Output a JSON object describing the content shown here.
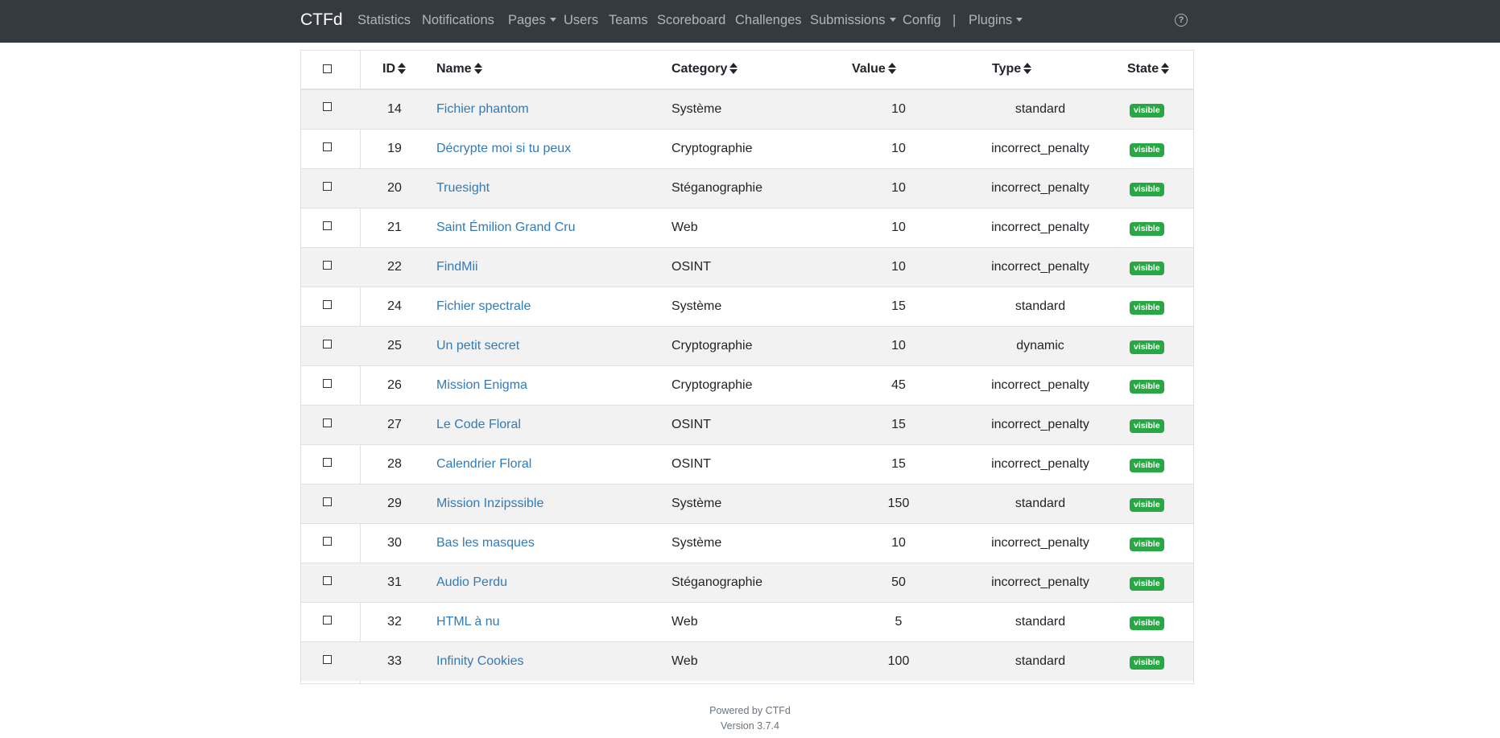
{
  "navbar": {
    "brand": "CTFd",
    "items": [
      {
        "label": "Statistics"
      },
      {
        "label": "Notifications"
      },
      {
        "label": "Pages",
        "dropdown": true
      },
      {
        "label": "Users"
      },
      {
        "label": "Teams"
      },
      {
        "label": "Scoreboard"
      },
      {
        "label": "Challenges"
      },
      {
        "label": "Submissions",
        "dropdown": true
      },
      {
        "label": "Config"
      },
      {
        "label": "|"
      },
      {
        "label": "Plugins",
        "dropdown": true
      }
    ],
    "help_icon": "question-circle-icon",
    "background": "#343a40"
  },
  "table": {
    "headers": {
      "id": "ID",
      "name": "Name",
      "category": "Category",
      "value": "Value",
      "type": "Type",
      "state": "State"
    },
    "rows": [
      {
        "id": "14",
        "name": "Fichier phantom",
        "category": "Système",
        "value": "10",
        "type": "standard",
        "state": "visible"
      },
      {
        "id": "19",
        "name": "Décrypte moi si tu peux",
        "category": "Cryptographie",
        "value": "10",
        "type": "incorrect_penalty",
        "state": "visible"
      },
      {
        "id": "20",
        "name": "Truesight",
        "category": "Stéganographie",
        "value": "10",
        "type": "incorrect_penalty",
        "state": "visible"
      },
      {
        "id": "21",
        "name": "Saint Émilion Grand Cru",
        "category": "Web",
        "value": "10",
        "type": "incorrect_penalty",
        "state": "visible"
      },
      {
        "id": "22",
        "name": "FindMii",
        "category": "OSINT",
        "value": "10",
        "type": "incorrect_penalty",
        "state": "visible"
      },
      {
        "id": "24",
        "name": "Fichier spectrale",
        "category": "Système",
        "value": "15",
        "type": "standard",
        "state": "visible"
      },
      {
        "id": "25",
        "name": "Un petit secret",
        "category": "Cryptographie",
        "value": "10",
        "type": "dynamic",
        "state": "visible"
      },
      {
        "id": "26",
        "name": "Mission Enigma",
        "category": "Cryptographie",
        "value": "45",
        "type": "incorrect_penalty",
        "state": "visible"
      },
      {
        "id": "27",
        "name": "Le Code Floral",
        "category": "OSINT",
        "value": "15",
        "type": "incorrect_penalty",
        "state": "visible"
      },
      {
        "id": "28",
        "name": "Calendrier Floral",
        "category": "OSINT",
        "value": "15",
        "type": "incorrect_penalty",
        "state": "visible"
      },
      {
        "id": "29",
        "name": "Mission Inzipssible",
        "category": "Système",
        "value": "150",
        "type": "standard",
        "state": "visible"
      },
      {
        "id": "30",
        "name": "Bas les masques",
        "category": "Système",
        "value": "10",
        "type": "incorrect_penalty",
        "state": "visible"
      },
      {
        "id": "31",
        "name": "Audio Perdu",
        "category": "Stéganographie",
        "value": "50",
        "type": "incorrect_penalty",
        "state": "visible"
      },
      {
        "id": "32",
        "name": "HTML à nu",
        "category": "Web",
        "value": "5",
        "type": "standard",
        "state": "visible"
      },
      {
        "id": "33",
        "name": "Infinity Cookies",
        "category": "Web",
        "value": "100",
        "type": "standard",
        "state": "visible"
      }
    ]
  },
  "footer": {
    "powered": "Powered by CTFd",
    "version": "Version 3.7.4"
  },
  "colors": {
    "link": "#337ab7",
    "badge_visible": "#28a745",
    "stripe": "#f2f2f2"
  }
}
